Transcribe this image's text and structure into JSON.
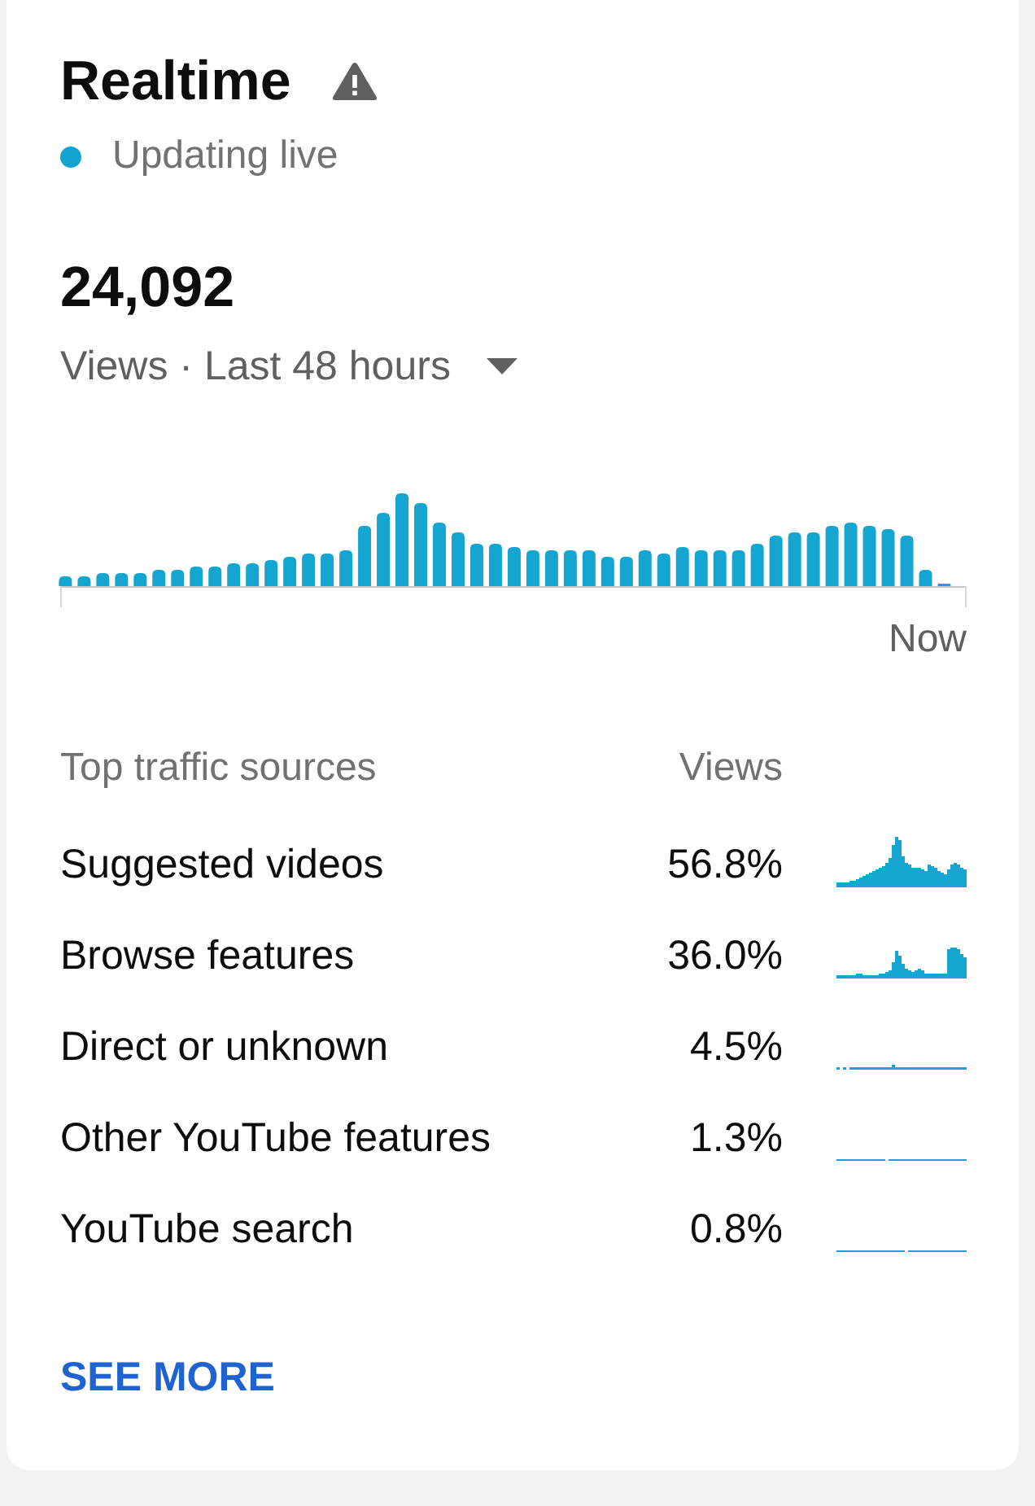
{
  "header": {
    "title": "Realtime",
    "status": {
      "label": "Updating live",
      "live": true
    }
  },
  "summary": {
    "total": "24,092",
    "metric_selector": "Views · Last 48 hours"
  },
  "chart": {
    "axis_end_label": "Now"
  },
  "traffic_sources": {
    "columns": [
      "Top traffic sources",
      "Views"
    ],
    "rows": [
      {
        "source": "Suggested videos",
        "share": "56.8%"
      },
      {
        "source": "Browse features",
        "share": "36.0%"
      },
      {
        "source": "Direct or unknown",
        "share": "4.5%"
      },
      {
        "source": "Other YouTube features",
        "share": "1.3%"
      },
      {
        "source": "YouTube search",
        "share": "0.8%"
      }
    ]
  },
  "action": "SEE MORE"
}
